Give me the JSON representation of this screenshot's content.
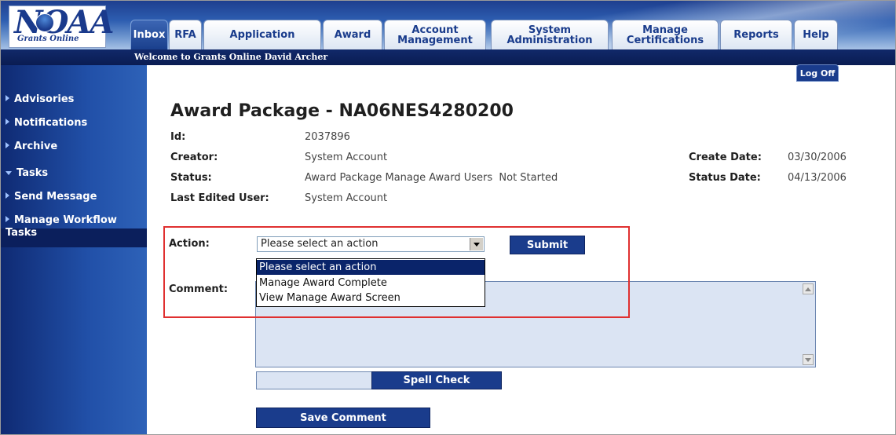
{
  "logo": {
    "main": "NOAA",
    "sub": "Grants Online"
  },
  "tabs": [
    {
      "label": "Inbox"
    },
    {
      "label": "RFA"
    },
    {
      "label": "Application"
    },
    {
      "label": "Award"
    },
    {
      "label": "Account Management"
    },
    {
      "label": "System Administration"
    },
    {
      "label": "Manage Certifications"
    },
    {
      "label": "Reports"
    },
    {
      "label": "Help"
    }
  ],
  "welcome": "Welcome to Grants Online David Archer",
  "logoff": "Log Off",
  "sidebar": {
    "items": [
      {
        "label": "Advisories"
      },
      {
        "label": "Notifications"
      },
      {
        "label": "Archive"
      },
      {
        "label": "Tasks"
      },
      {
        "label": "Send Message"
      },
      {
        "label": "Manage Workflow Tasks"
      }
    ]
  },
  "page": {
    "title": "Award Package - NA06NES4280200",
    "id_label": "Id:",
    "id_value": "2037896",
    "creator_label": "Creator:",
    "creator_value": "System Account",
    "status_label": "Status:",
    "status_value": "Award Package Manage Award Users  Not Started",
    "last_edited_label": "Last Edited User:",
    "last_edited_value": "System Account",
    "create_date_label": "Create Date:",
    "create_date_value": "03/30/2006",
    "status_date_label": "Status Date:",
    "status_date_value": "04/13/2006"
  },
  "form": {
    "action_label": "Action:",
    "action_selected": "Please select an action",
    "action_options": [
      "Please select an action",
      "Manage Award Complete",
      "View Manage Award Screen"
    ],
    "submit": "Submit",
    "comment_label": "Comment:",
    "spell_check": "Spell Check",
    "save_comment": "Save Comment"
  },
  "colors": {
    "nav_blue": "#1a3c8c",
    "highlight_red": "#e03030",
    "textarea_bg": "#dbe4f3"
  }
}
